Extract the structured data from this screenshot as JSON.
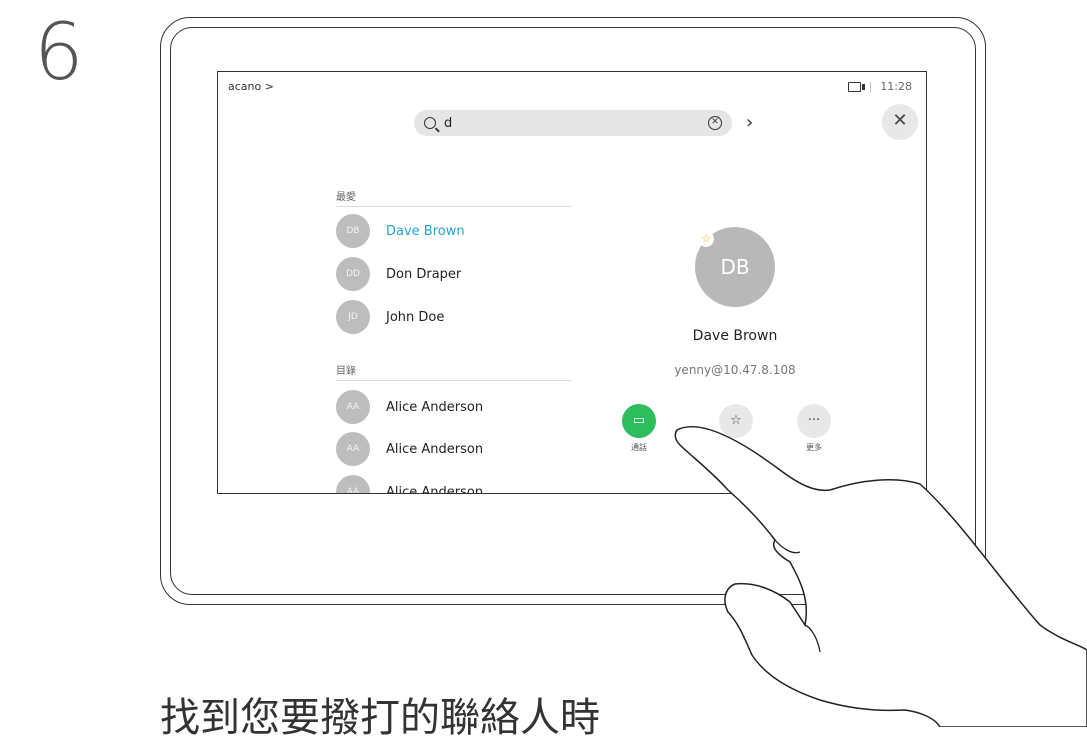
{
  "step": {
    "number": "6"
  },
  "screen": {
    "breadcrumb": "acano >",
    "time": "11:28",
    "search": {
      "value": "d"
    },
    "sections": {
      "favorites": "最愛",
      "directory": "目錄"
    },
    "favorites": [
      {
        "initials": "DB",
        "name": "Dave Brown",
        "active": true
      },
      {
        "initials": "DD",
        "name": "Don Draper"
      },
      {
        "initials": "JD",
        "name": "John Doe"
      }
    ],
    "directory": [
      {
        "initials": "AA",
        "name": "Alice Anderson"
      },
      {
        "initials": "AA",
        "name": "Alice Anderson"
      },
      {
        "initials": "AA",
        "name": "Alice Anderson"
      }
    ],
    "detail": {
      "initials": "DB",
      "name": "Dave Brown",
      "address": "yenny@10.47.8.108"
    },
    "actions": {
      "call_label": "通話",
      "more_label": "更多"
    }
  },
  "caption": "找到您要撥打的聯絡人時"
}
